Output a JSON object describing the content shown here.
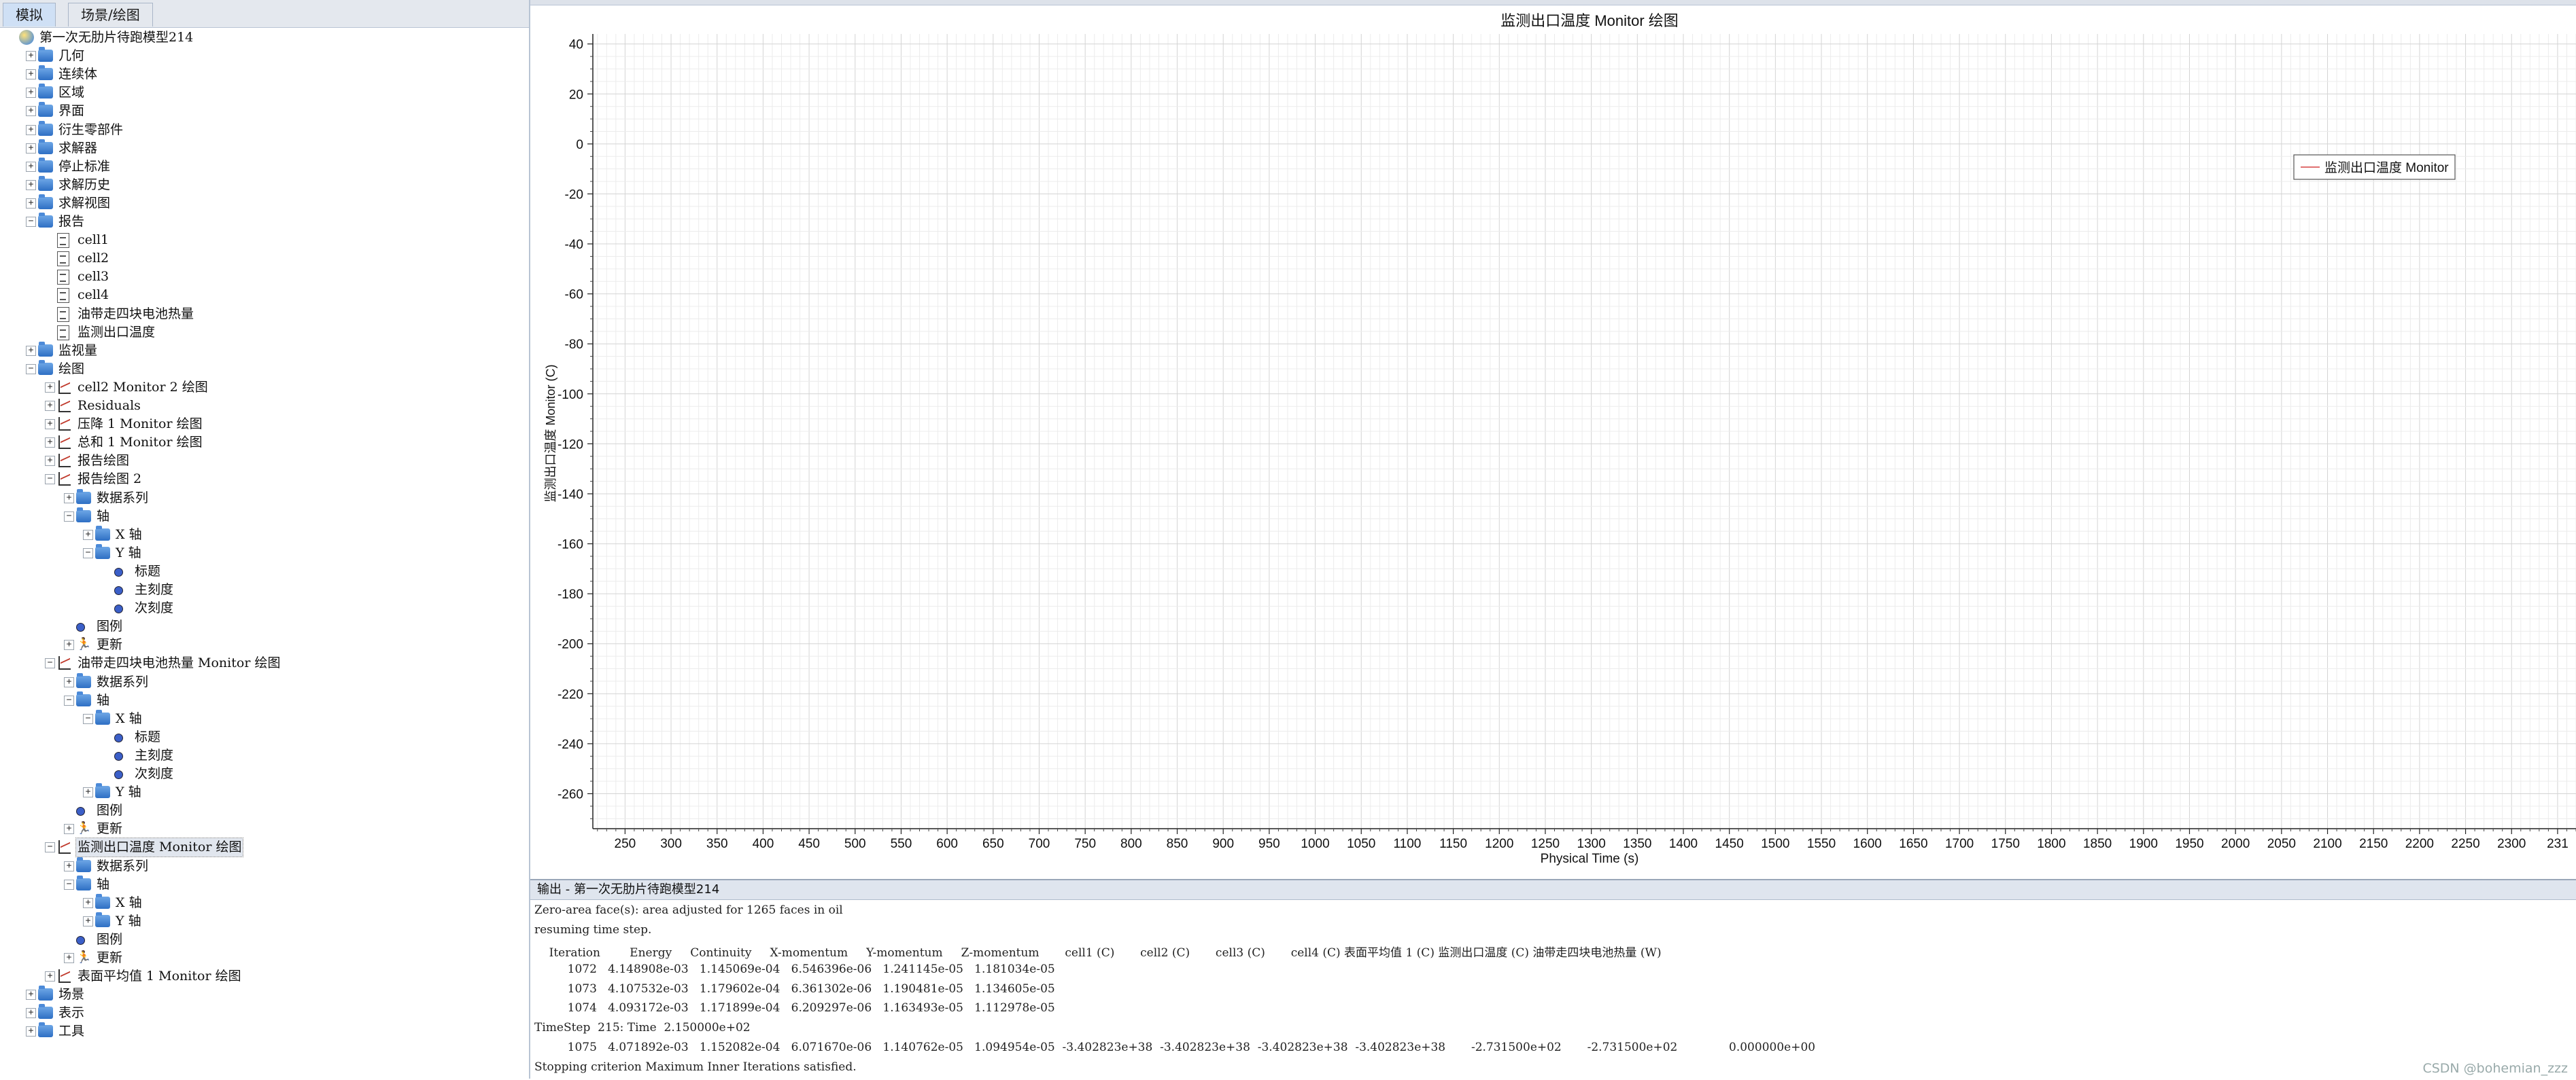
{
  "tabs": [
    "模拟",
    "场景/绘图"
  ],
  "tree": [
    {
      "label": "第一次无肋片待跑模型214",
      "level": 0,
      "icon": "globe",
      "exp": ""
    },
    {
      "label": "几何",
      "level": 1,
      "icon": "folder",
      "exp": "+"
    },
    {
      "label": "连续体",
      "level": 1,
      "icon": "folder",
      "exp": "+"
    },
    {
      "label": "区域",
      "level": 1,
      "icon": "folder",
      "exp": "+"
    },
    {
      "label": "界面",
      "level": 1,
      "icon": "folder",
      "exp": "+"
    },
    {
      "label": "衍生零部件",
      "level": 1,
      "icon": "folder",
      "exp": "+"
    },
    {
      "label": "求解器",
      "level": 1,
      "icon": "folder",
      "exp": "+"
    },
    {
      "label": "停止标准",
      "level": 1,
      "icon": "folder",
      "exp": "+"
    },
    {
      "label": "求解历史",
      "level": 1,
      "icon": "folder",
      "exp": "+"
    },
    {
      "label": "求解视图",
      "level": 1,
      "icon": "folder",
      "exp": "+"
    },
    {
      "label": "报告",
      "level": 1,
      "icon": "folder",
      "exp": "-"
    },
    {
      "label": "cell1",
      "level": 2,
      "icon": "doc",
      "exp": ""
    },
    {
      "label": "cell2",
      "level": 2,
      "icon": "doc",
      "exp": ""
    },
    {
      "label": "cell3",
      "level": 2,
      "icon": "doc",
      "exp": ""
    },
    {
      "label": "cell4",
      "level": 2,
      "icon": "doc",
      "exp": ""
    },
    {
      "label": "油带走四块电池热量",
      "level": 2,
      "icon": "doc",
      "exp": ""
    },
    {
      "label": "监测出口温度",
      "level": 2,
      "icon": "doc",
      "exp": ""
    },
    {
      "label": "监视量",
      "level": 1,
      "icon": "folder",
      "exp": "+"
    },
    {
      "label": "绘图",
      "level": 1,
      "icon": "folder",
      "exp": "-"
    },
    {
      "label": "cell2 Monitor 2 绘图",
      "level": 2,
      "icon": "plot",
      "exp": "+"
    },
    {
      "label": "Residuals",
      "level": 2,
      "icon": "plot",
      "exp": "+"
    },
    {
      "label": "压降 1 Monitor 绘图",
      "level": 2,
      "icon": "plot",
      "exp": "+"
    },
    {
      "label": "总和 1 Monitor 绘图",
      "level": 2,
      "icon": "plot",
      "exp": "+"
    },
    {
      "label": "报告绘图",
      "level": 2,
      "icon": "plot",
      "exp": "+"
    },
    {
      "label": "报告绘图 2",
      "level": 2,
      "icon": "plot",
      "exp": "-"
    },
    {
      "label": "数据系列",
      "level": 3,
      "icon": "folder",
      "exp": "+"
    },
    {
      "label": "轴",
      "level": 3,
      "icon": "folder",
      "exp": "-"
    },
    {
      "label": "X 轴",
      "level": 4,
      "icon": "folder",
      "exp": "+"
    },
    {
      "label": "Y 轴",
      "level": 4,
      "icon": "folder",
      "exp": "-"
    },
    {
      "label": "标题",
      "level": 5,
      "icon": "dot",
      "exp": ""
    },
    {
      "label": "主刻度",
      "level": 5,
      "icon": "dot",
      "exp": ""
    },
    {
      "label": "次刻度",
      "level": 5,
      "icon": "dot",
      "exp": ""
    },
    {
      "label": "图例",
      "level": 3,
      "icon": "dot",
      "exp": ""
    },
    {
      "label": "更新",
      "level": 3,
      "icon": "run",
      "exp": "+"
    },
    {
      "label": "油带走四块电池热量 Monitor 绘图",
      "level": 2,
      "icon": "plot",
      "exp": "-"
    },
    {
      "label": "数据系列",
      "level": 3,
      "icon": "folder",
      "exp": "+"
    },
    {
      "label": "轴",
      "level": 3,
      "icon": "folder",
      "exp": "-"
    },
    {
      "label": "X 轴",
      "level": 4,
      "icon": "folder",
      "exp": "-"
    },
    {
      "label": "标题",
      "level": 5,
      "icon": "dot",
      "exp": ""
    },
    {
      "label": "主刻度",
      "level": 5,
      "icon": "dot",
      "exp": ""
    },
    {
      "label": "次刻度",
      "level": 5,
      "icon": "dot",
      "exp": ""
    },
    {
      "label": "Y 轴",
      "level": 4,
      "icon": "folder",
      "exp": "+"
    },
    {
      "label": "图例",
      "level": 3,
      "icon": "dot",
      "exp": ""
    },
    {
      "label": "更新",
      "level": 3,
      "icon": "run",
      "exp": "+"
    },
    {
      "label": "监测出口温度 Monitor 绘图",
      "level": 2,
      "icon": "plot",
      "exp": "-",
      "selected": true
    },
    {
      "label": "数据系列",
      "level": 3,
      "icon": "folder",
      "exp": "+"
    },
    {
      "label": "轴",
      "level": 3,
      "icon": "folder",
      "exp": "-"
    },
    {
      "label": "X 轴",
      "level": 4,
      "icon": "folder",
      "exp": "+"
    },
    {
      "label": "Y 轴",
      "level": 4,
      "icon": "folder",
      "exp": "+"
    },
    {
      "label": "图例",
      "level": 3,
      "icon": "dot",
      "exp": ""
    },
    {
      "label": "更新",
      "level": 3,
      "icon": "run",
      "exp": "+"
    },
    {
      "label": "表面平均值 1 Monitor 绘图",
      "level": 2,
      "icon": "plot",
      "exp": "+"
    },
    {
      "label": "场景",
      "level": 1,
      "icon": "folder",
      "exp": "+"
    },
    {
      "label": "表示",
      "level": 1,
      "icon": "folder",
      "exp": "+"
    },
    {
      "label": "工具",
      "level": 1,
      "icon": "folder",
      "exp": "+"
    }
  ],
  "chart_data": {
    "type": "line",
    "title": "监测出口温度 Monitor 绘图",
    "xlabel": "Physical Time (s)",
    "ylabel": "监测出口温度 Monitor (C)",
    "xlim": [
      215,
      2370
    ],
    "ylim": [
      -274,
      44
    ],
    "xticks": [
      250,
      300,
      350,
      400,
      450,
      500,
      550,
      600,
      650,
      700,
      750,
      800,
      850,
      900,
      950,
      1000,
      1050,
      1100,
      1150,
      1200,
      1250,
      1300,
      1350,
      1400,
      1450,
      1500,
      1550,
      1600,
      1650,
      1700,
      1750,
      1800,
      1850,
      1900,
      1950,
      2000,
      2050,
      2100,
      2150,
      2200,
      2250,
      2300,
      "231"
    ],
    "yticks": [
      40,
      20,
      0,
      -20,
      -40,
      -60,
      -80,
      -100,
      -120,
      -140,
      -160,
      -180,
      -200,
      -220,
      -240,
      -260
    ],
    "grid": true,
    "legend_position": "upper-right",
    "series": [
      {
        "name": "监测出口温度 Monitor",
        "color": "#e07070",
        "x": [],
        "y": []
      }
    ]
  },
  "output": {
    "title": "输出 - 第一次无肋片待跑模型214",
    "lines": [
      "Zero-area face(s): area adjusted for 1265 faces in oil",
      "resuming time step.",
      "    Iteration        Energy     Continuity     X-momentum     Y-momentum     Z-momentum       cell1 (C)       cell2 (C)       cell3 (C)       cell4 (C) 表面平均值 1 (C) 监测出口温度 (C) 油带走四块电池热量 (W)",
      "         1072   4.148908e-03   1.145069e-04   6.546396e-06   1.241145e-05   1.181034e-05",
      "         1073   4.107532e-03   1.179602e-04   6.361302e-06   1.190481e-05   1.134605e-05",
      "         1074   4.093172e-03   1.171899e-04   6.209297e-06   1.163493e-05   1.112978e-05",
      "TimeStep  215: Time  2.150000e+02",
      "         1075   4.071892e-03   1.152082e-04   6.071670e-06   1.140762e-05   1.094954e-05  -3.402823e+38  -3.402823e+38  -3.402823e+38  -3.402823e+38       -2.731500e+02       -2.731500e+02              0.000000e+00",
      "Stopping criterion Maximum Inner Iterations satisfied."
    ]
  },
  "watermark": "CSDN @bohemian_zzz"
}
